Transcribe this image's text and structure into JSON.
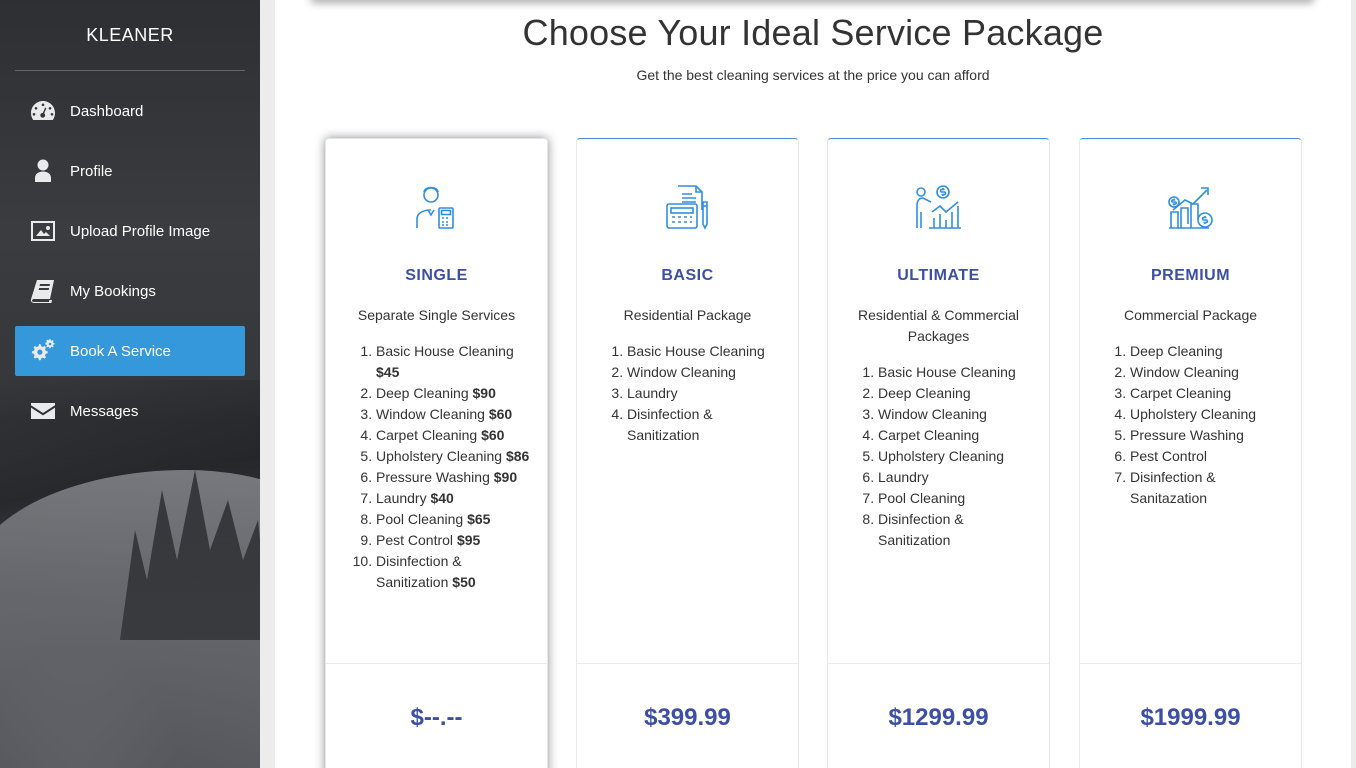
{
  "app": {
    "brand": "KLEANER"
  },
  "sidebar": {
    "items": [
      {
        "label": "Dashboard",
        "icon": "dashboard-icon",
        "active": false
      },
      {
        "label": "Profile",
        "icon": "user-icon",
        "active": false
      },
      {
        "label": "Upload Profile Image",
        "icon": "image-icon",
        "active": false
      },
      {
        "label": "My Bookings",
        "icon": "book-icon",
        "active": false
      },
      {
        "label": "Book A Service",
        "icon": "gears-icon",
        "active": true
      },
      {
        "label": "Messages",
        "icon": "envelope-icon",
        "active": false
      }
    ]
  },
  "page": {
    "title": "Choose Your Ideal Service Package",
    "subtitle": "Get the best cleaning services at the price you can afford"
  },
  "packages": [
    {
      "name": "SINGLE",
      "icon": "worker-calculator-icon",
      "description": "Separate Single Services",
      "items": [
        {
          "text": "Basic House Cleaning",
          "price": "$45"
        },
        {
          "text": "Deep Cleaning",
          "price": "$90"
        },
        {
          "text": "Window Cleaning",
          "price": "$60"
        },
        {
          "text": "Carpet Cleaning",
          "price": "$60"
        },
        {
          "text": "Upholstery Cleaning",
          "price": "$86"
        },
        {
          "text": "Pressure Washing",
          "price": "$90"
        },
        {
          "text": "Laundry",
          "price": "$40"
        },
        {
          "text": "Pool Cleaning",
          "price": "$65"
        },
        {
          "text": "Pest Control",
          "price": "$95"
        },
        {
          "text": "Disinfection & Sanitization",
          "price": "$50"
        }
      ],
      "price": "$--.--"
    },
    {
      "name": "BASIC",
      "icon": "calculator-invoice-icon",
      "description": "Residential Package",
      "items": [
        {
          "text": "Basic House Cleaning",
          "price": ""
        },
        {
          "text": "Window Cleaning",
          "price": ""
        },
        {
          "text": "Laundry",
          "price": ""
        },
        {
          "text": "Disinfection & Sanitization",
          "price": ""
        }
      ],
      "price": "$399.99"
    },
    {
      "name": "ULTIMATE",
      "icon": "presenter-chart-icon",
      "description": "Residential & Commercial Packages",
      "items": [
        {
          "text": "Basic House Cleaning",
          "price": ""
        },
        {
          "text": "Deep Cleaning",
          "price": ""
        },
        {
          "text": "Window Cleaning",
          "price": ""
        },
        {
          "text": "Carpet Cleaning",
          "price": ""
        },
        {
          "text": "Upholstery Cleaning",
          "price": ""
        },
        {
          "text": "Laundry",
          "price": ""
        },
        {
          "text": "Pool Cleaning",
          "price": ""
        },
        {
          "text": "Disinfection & Sanitization",
          "price": ""
        }
      ],
      "price": "$1299.99"
    },
    {
      "name": "PREMIUM",
      "icon": "growth-chart-icon",
      "description": "Commercial Package",
      "items": [
        {
          "text": "Deep Cleaning",
          "price": ""
        },
        {
          "text": "Window Cleaning",
          "price": ""
        },
        {
          "text": "Carpet Cleaning",
          "price": ""
        },
        {
          "text": "Upholstery Cleaning",
          "price": ""
        },
        {
          "text": "Pressure Washing",
          "price": ""
        },
        {
          "text": "Pest Control",
          "price": ""
        },
        {
          "text": "Disinfection & Sanitazation",
          "price": ""
        }
      ],
      "price": "$1999.99"
    }
  ],
  "colors": {
    "accent": "#3498db",
    "package_title": "#3c4fa3",
    "icon_blue": "#2f8fe0"
  }
}
